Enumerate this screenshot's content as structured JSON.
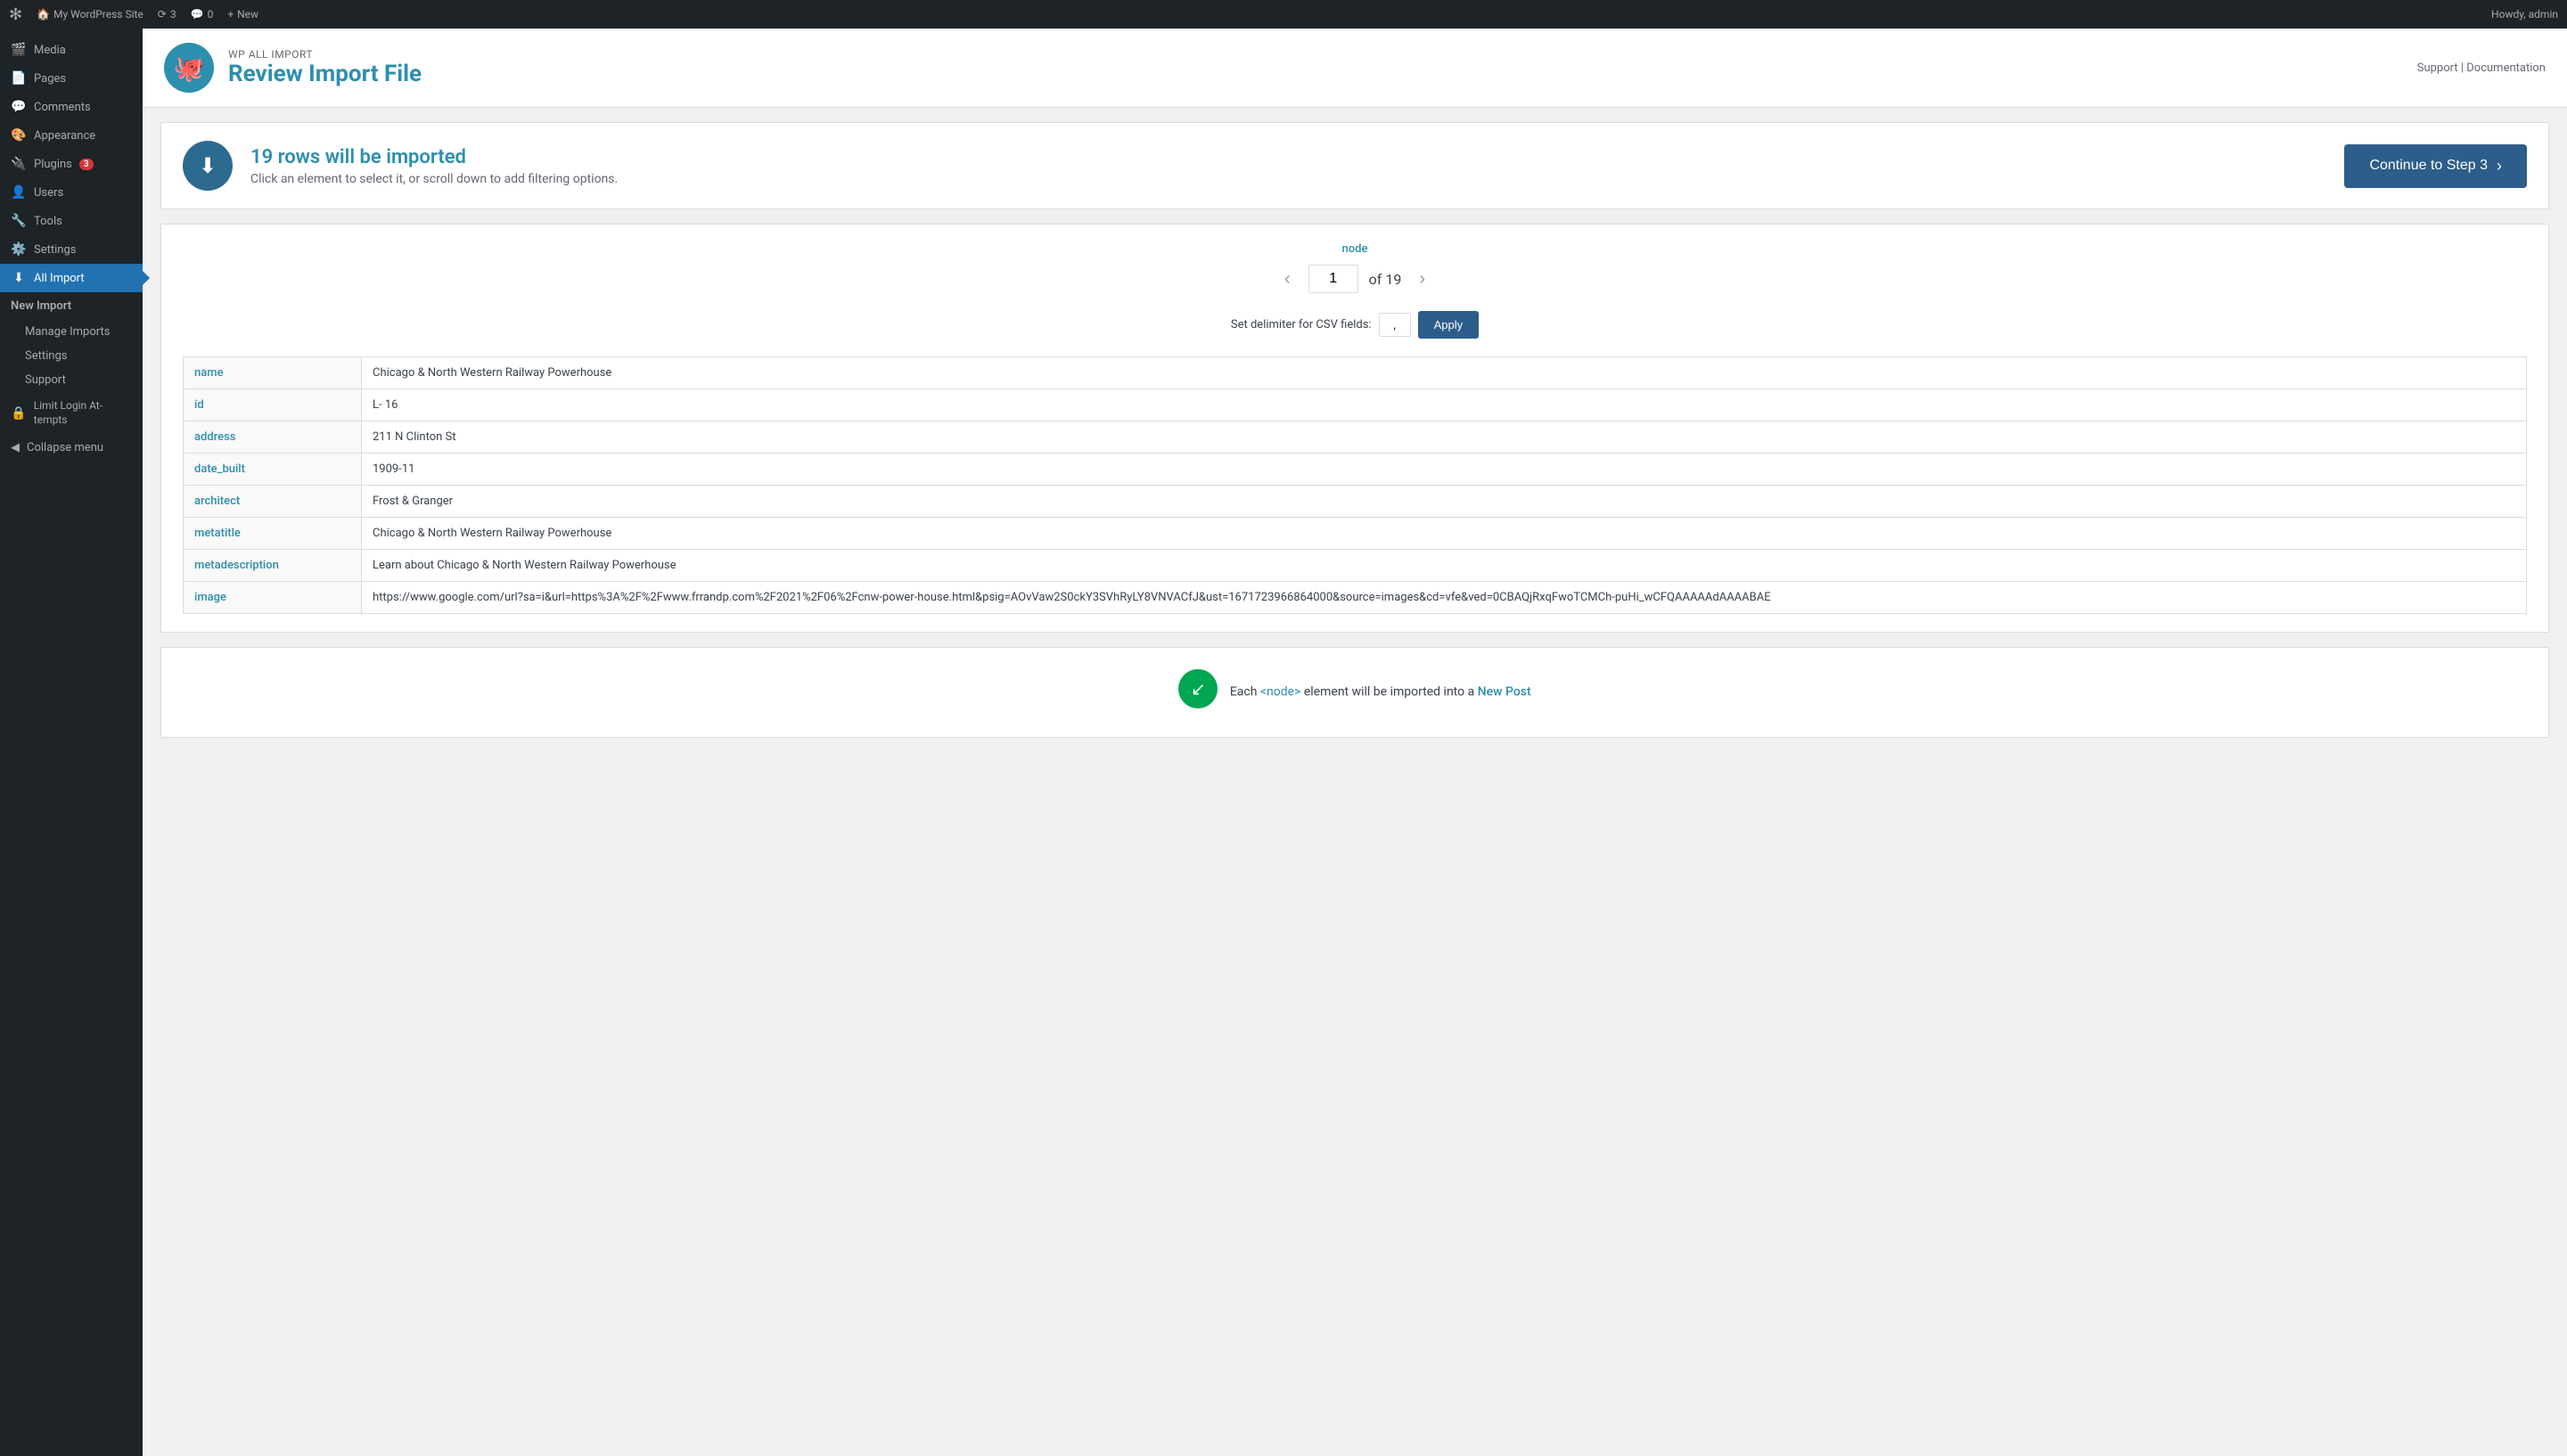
{
  "topbar": {
    "logo": "✻",
    "site_name": "My WordPress Site",
    "updates_count": "3",
    "comments_count": "0",
    "new_label": "New",
    "howdy": "Howdy, admin"
  },
  "sidebar": {
    "items": [
      {
        "id": "media",
        "label": "Media",
        "icon": "🎬"
      },
      {
        "id": "pages",
        "label": "Pages",
        "icon": "📄"
      },
      {
        "id": "comments",
        "label": "Comments",
        "icon": "💬"
      },
      {
        "id": "appearance",
        "label": "Appearance",
        "icon": "🎨"
      },
      {
        "id": "plugins",
        "label": "Plugins",
        "icon": "🔌",
        "badge": "3"
      },
      {
        "id": "users",
        "label": "Users",
        "icon": "👤"
      },
      {
        "id": "tools",
        "label": "Tools",
        "icon": "🔧"
      },
      {
        "id": "settings",
        "label": "Settings",
        "icon": "⚙️"
      },
      {
        "id": "all-import",
        "label": "All Import",
        "icon": "⬇",
        "active": true
      }
    ],
    "submenu": [
      {
        "id": "new-import",
        "label": "New Import",
        "active": true
      },
      {
        "id": "manage-imports",
        "label": "Manage Imports"
      },
      {
        "id": "settings",
        "label": "Settings"
      },
      {
        "id": "support",
        "label": "Support"
      }
    ],
    "other_plugins": [
      {
        "id": "limit-login",
        "label": "Limit Login Attempts"
      }
    ],
    "collapse_label": "Collapse menu"
  },
  "plugin": {
    "brand": "WP ALL IMPORT",
    "title": "Review Import File",
    "logo_icon": "🐙",
    "support_label": "Support",
    "separator": "|",
    "documentation_label": "Documentation"
  },
  "import_summary": {
    "icon": "⬇",
    "rows_count": "19",
    "rows_text": " rows will be imported",
    "subtitle": "Click an element to select it, or scroll down to add filtering options.",
    "continue_btn": "Continue to Step 3",
    "continue_icon": "›"
  },
  "node_section": {
    "node_label": "node",
    "current_page": "1",
    "total_pages": "19",
    "of_text": "of",
    "prev_icon": "‹",
    "next_icon": "›"
  },
  "csv": {
    "delimiter_label": "Set delimiter for CSV fields:",
    "delimiter_value": ",",
    "apply_label": "Apply"
  },
  "table": {
    "rows": [
      {
        "field": "name",
        "value": "Chicago & North Western Railway Powerhouse"
      },
      {
        "field": "id",
        "value": "L- 16"
      },
      {
        "field": "address",
        "value": "211 N Clinton St"
      },
      {
        "field": "date_built",
        "value": "1909-11"
      },
      {
        "field": "architect",
        "value": "Frost & Granger"
      },
      {
        "field": "metatitle",
        "value": "Chicago & North Western Railway Powerhouse"
      },
      {
        "field": "metadescription",
        "value": "Learn about Chicago & North Western Railway Powerhouse"
      },
      {
        "field": "image",
        "value": "https://www.google.com/url?sa=i&url=https%3A%2F%2Fwww.frrandp.com%2F2021%2F06%2Fcnw-power-house.html&psig=AOvVaw2S0ckY3SVhRyLY8VNVACfJ&ust=1671723966864000&source=images&cd=vfe&ved=0CBAQjRxqFwoTCMCh-puHi_wCFQAAAAAdAAAABAE"
      }
    ]
  },
  "import_note": {
    "icon": "↙",
    "text_before": "Each ",
    "node_tag": "<node>",
    "text_middle": " element will be imported into a ",
    "new_post_link": "New Post"
  }
}
